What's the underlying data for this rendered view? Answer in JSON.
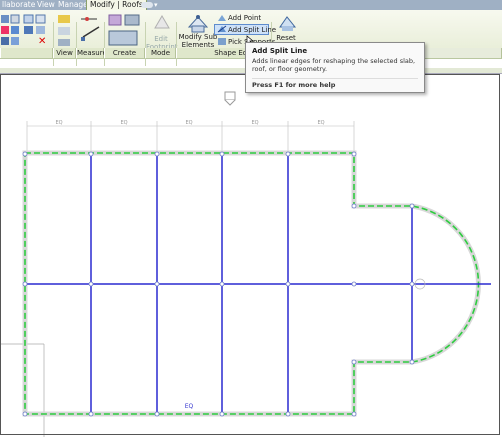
{
  "menu": {
    "tabs": [
      "llaborate",
      "View",
      "Manage",
      "Modify | Roofs"
    ],
    "active_tab": "Modify | Roofs"
  },
  "ribbon": {
    "panels": [
      "View",
      "Measure",
      "Create",
      "Mode",
      "Shape Editing"
    ],
    "mode": {
      "edit_footprint": "Edit Footprint"
    },
    "shape_editing": {
      "modify_sub_elements": "Modify Sub Elements",
      "add_point": "Add Point",
      "add_split_line": "Add Split Line",
      "pick_supports": "Pick Supports",
      "reset_shape": "Reset Shape"
    }
  },
  "tooltip": {
    "title": "Add Split Line",
    "description": "Adds linear edges for reshaping the selected slab, roof, or floor geometry.",
    "help": "Press F1 for more help"
  },
  "drawing": {
    "top_dimension_labels": [
      "EQ",
      "EQ",
      "EQ",
      "EQ",
      "EQ"
    ],
    "bottom_dimension_label": "EQ"
  },
  "colors": {
    "ribbon_active": "#f4f6e8",
    "split_line": "#2a2ad0",
    "boundary_dash": "#2ecc40",
    "edge": "#b9b9b9"
  }
}
